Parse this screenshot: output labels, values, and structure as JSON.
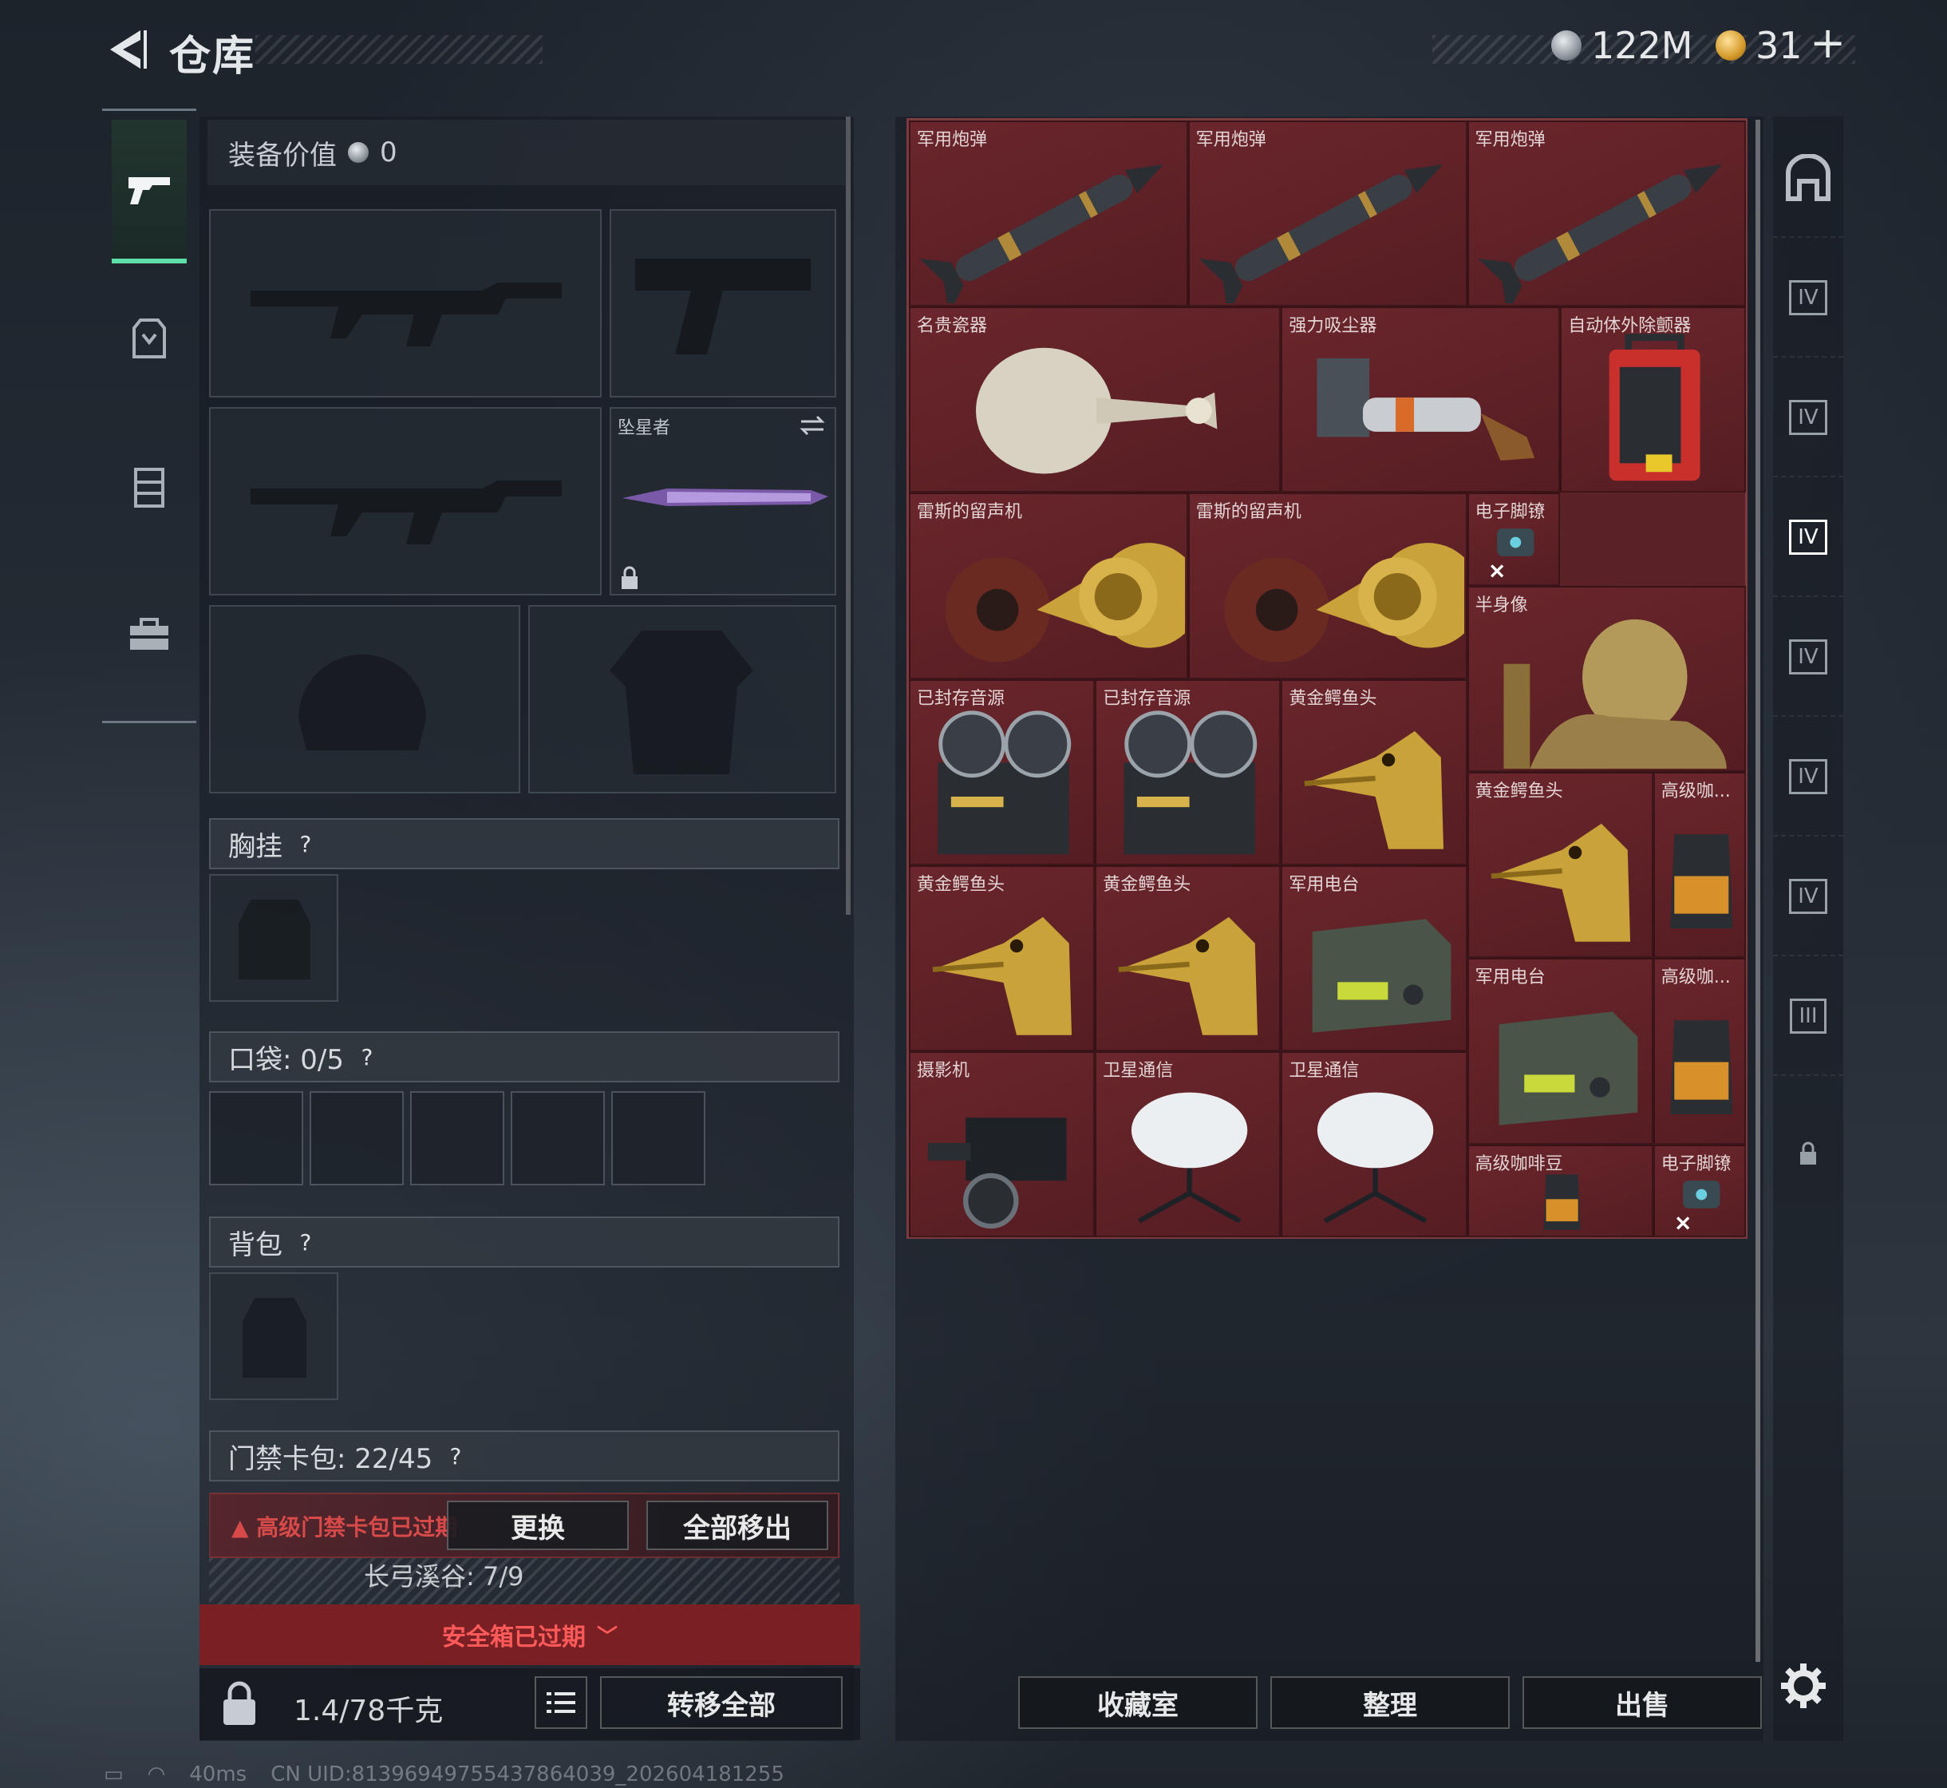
{
  "header": {
    "title": "仓库",
    "currency1": "122M",
    "currency2": "31",
    "plus": "+"
  },
  "left_rail": [
    {
      "id": "weapons",
      "icon": "gun-icon",
      "active": true
    },
    {
      "id": "armor",
      "icon": "armor-icon"
    },
    {
      "id": "chest",
      "icon": "chest-rig-icon"
    },
    {
      "id": "tools",
      "icon": "toolbox-icon"
    }
  ],
  "equipment": {
    "value_label": "装备价值",
    "value": "0",
    "melee_label": "坠星者",
    "chest_label": "胸挂",
    "pocket_label": "口袋: 0/5",
    "backpack_label": "背包",
    "keycard_label": "门禁卡包: 22/45",
    "warning": "高级门禁卡包已过期",
    "swap": "更换",
    "move_all": "全部移出",
    "keyslot": "长弓溪谷: 7/9",
    "safebox": "安全箱已过期",
    "weight": "1.4/78千克",
    "transfer_all": "转移全部"
  },
  "storage": {
    "items": [
      {
        "name": "军用炮弹",
        "icon": "missile-icon"
      },
      {
        "name": "军用炮弹",
        "icon": "missile-icon"
      },
      {
        "name": "军用炮弹",
        "icon": "missile-icon"
      },
      {
        "name": "名贵瓷器",
        "icon": "vase-icon"
      },
      {
        "name": "强力吸尘器",
        "icon": "vacuum-icon"
      },
      {
        "name": "自动体外除颤器",
        "icon": "aed-icon"
      },
      {
        "name": "雷斯的留声机",
        "icon": "gramophone-icon"
      },
      {
        "name": "雷斯的留声机",
        "icon": "gramophone-icon"
      },
      {
        "name": "电子脚镣",
        "icon": "anklet-icon"
      },
      {
        "name": "半身像",
        "icon": "bust-icon"
      },
      {
        "name": "已封存音源",
        "icon": "reel-icon"
      },
      {
        "name": "已封存音源",
        "icon": "reel-icon"
      },
      {
        "name": "黄金鳄鱼头",
        "icon": "croc-icon"
      },
      {
        "name": "黄金鳄鱼头",
        "icon": "croc-icon"
      },
      {
        "name": "高级咖...",
        "icon": "coffee-icon"
      },
      {
        "name": "黄金鳄鱼头",
        "icon": "croc-icon"
      },
      {
        "name": "黄金鳄鱼头",
        "icon": "croc-icon"
      },
      {
        "name": "军用电台",
        "icon": "radio-icon"
      },
      {
        "name": "军用电台",
        "icon": "radio-icon"
      },
      {
        "name": "高级咖...",
        "icon": "coffee-icon"
      },
      {
        "name": "摄影机",
        "icon": "camera-icon"
      },
      {
        "name": "卫星通信",
        "icon": "dish-icon"
      },
      {
        "name": "卫星通信",
        "icon": "dish-icon"
      },
      {
        "name": "高级咖啡豆",
        "icon": "coffee-icon"
      },
      {
        "name": "电子脚镣",
        "icon": "anklet-icon"
      }
    ],
    "btn_collection": "收藏室",
    "btn_arrange": "整理",
    "btn_sell": "出售"
  },
  "right_rail": {
    "labels": [
      "IV",
      "IV",
      "IV",
      "IV",
      "IV",
      "IV",
      "III"
    ]
  },
  "status": {
    "ping": "40ms",
    "uid": "CN UID:8139694975543786403​9_202604181255"
  },
  "colors": {
    "accent_green": "#5fe0a8",
    "item_bg": "#5a2227",
    "warn_red": "#d84a4a"
  }
}
